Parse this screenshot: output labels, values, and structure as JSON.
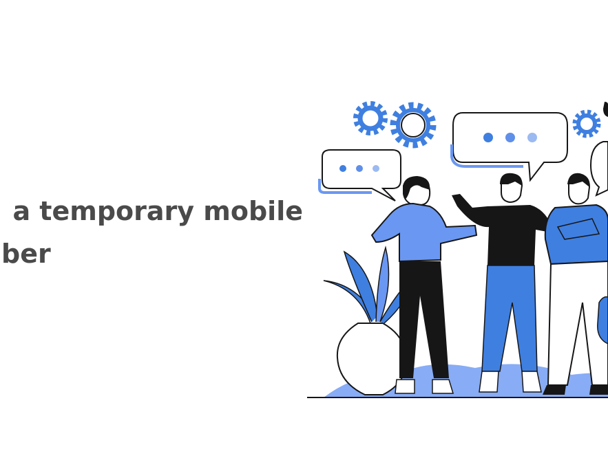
{
  "headline": {
    "line1": "a temporary mobile",
    "line2": "nber"
  },
  "illustration": {
    "name": "people-chatting-illustration",
    "colors": {
      "blue": "#3f7fe0",
      "light_blue": "#6a97f2",
      "black": "#161616",
      "white": "#ffffff"
    }
  }
}
